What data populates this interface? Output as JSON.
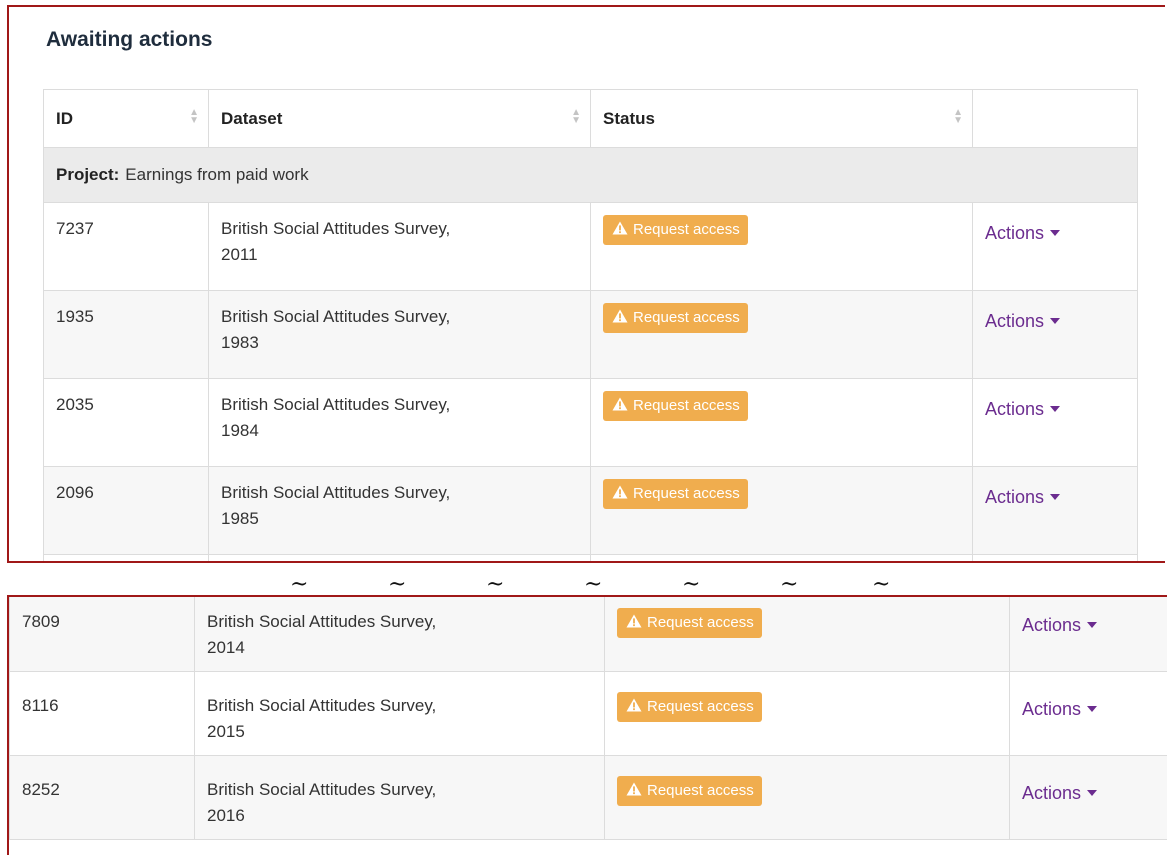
{
  "section_title": "Awaiting actions",
  "columns": [
    {
      "label": "ID"
    },
    {
      "label": "Dataset"
    },
    {
      "label": "Status"
    },
    {
      "label": ""
    }
  ],
  "project": {
    "label": "Project:",
    "name": "Earnings from paid work"
  },
  "status_icon": "warning-triangle-icon",
  "colors": {
    "badge": "#f0ad4e",
    "actions_link": "#6b2c8f",
    "frame": "#a01818"
  },
  "rows_top": [
    {
      "id": "7237",
      "dataset_line1": "British Social Attitudes Survey,",
      "dataset_line2": "2011",
      "status": "Request access",
      "action": "Actions"
    },
    {
      "id": "1935",
      "dataset_line1": "British Social Attitudes Survey,",
      "dataset_line2": "1983",
      "status": "Request access",
      "action": "Actions"
    },
    {
      "id": "2035",
      "dataset_line1": "British Social Attitudes Survey,",
      "dataset_line2": "1984",
      "status": "Request access",
      "action": "Actions"
    },
    {
      "id": "2096",
      "dataset_line1": "British Social Attitudes Survey,",
      "dataset_line2": "1985",
      "status": "Request access",
      "action": "Actions"
    }
  ],
  "separator": "~",
  "rows_bottom": [
    {
      "id": "7809",
      "dataset_line1": "British Social Attitudes Survey,",
      "dataset_line2": "2014",
      "status": "Request access",
      "action": "Actions"
    },
    {
      "id": "8116",
      "dataset_line1": "British Social Attitudes Survey,",
      "dataset_line2": "2015",
      "status": "Request access",
      "action": "Actions"
    },
    {
      "id": "8252",
      "dataset_line1": "British Social Attitudes Survey,",
      "dataset_line2": "2016",
      "status": "Request access",
      "action": "Actions"
    }
  ]
}
